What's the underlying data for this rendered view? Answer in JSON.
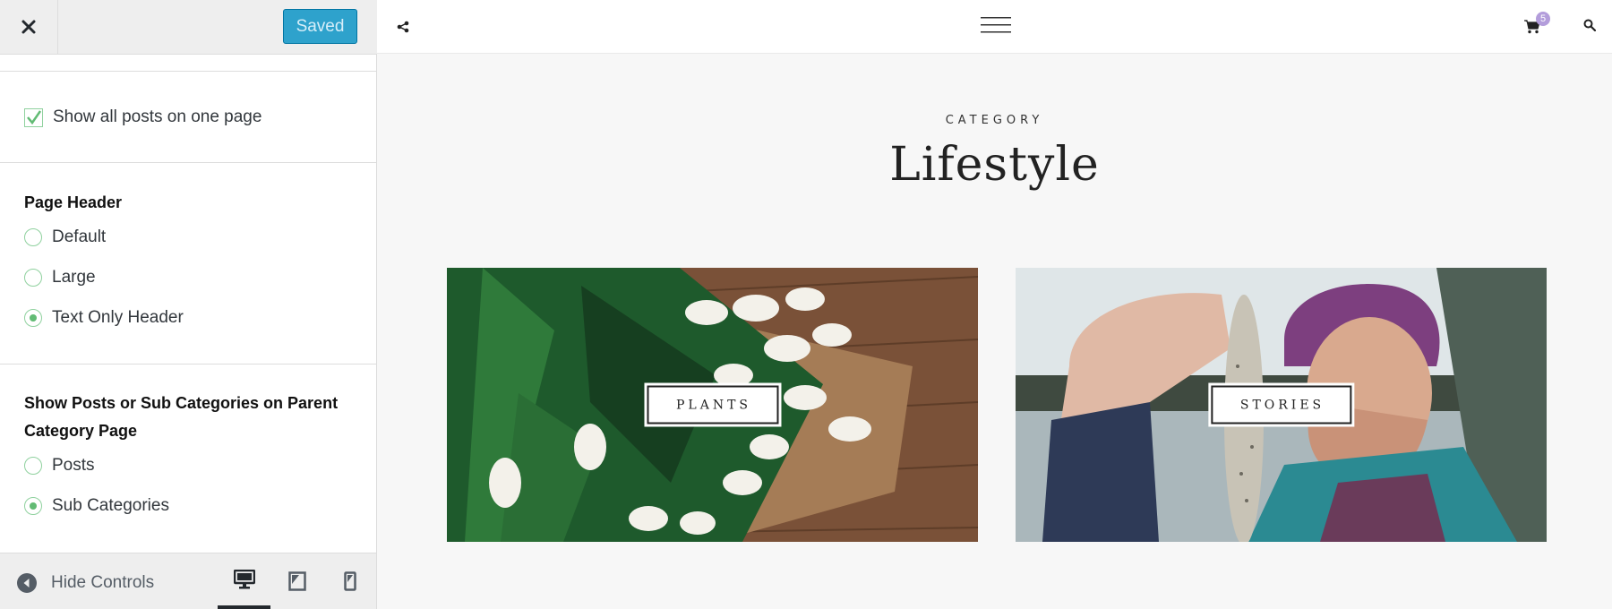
{
  "header": {
    "saved_label": "Saved"
  },
  "options": {
    "show_all_posts": {
      "label": "Show all posts on one page",
      "checked": true
    }
  },
  "page_header": {
    "title": "Page Header",
    "options": [
      {
        "label": "Default",
        "selected": false
      },
      {
        "label": "Large",
        "selected": false
      },
      {
        "label": "Text Only Header",
        "selected": true
      }
    ]
  },
  "parent_category": {
    "title": "Show Posts or Sub Categories on Parent Category Page",
    "options": [
      {
        "label": "Posts",
        "selected": false
      },
      {
        "label": "Sub Categories",
        "selected": true
      }
    ]
  },
  "footer": {
    "hide_controls_label": "Hide Controls",
    "devices": [
      "desktop-icon",
      "tablet-icon",
      "mobile-icon"
    ],
    "active_device": "desktop"
  },
  "preview": {
    "cart_count": "5",
    "category_label": "CATEGORY",
    "category_title": "Lifestyle",
    "cards": [
      {
        "label": "PLANTS"
      },
      {
        "label": "STORIES"
      }
    ]
  },
  "colors": {
    "accent": "#2ea2cc",
    "radio_green": "#62bb74",
    "cart_badge": "#b39ddb"
  }
}
